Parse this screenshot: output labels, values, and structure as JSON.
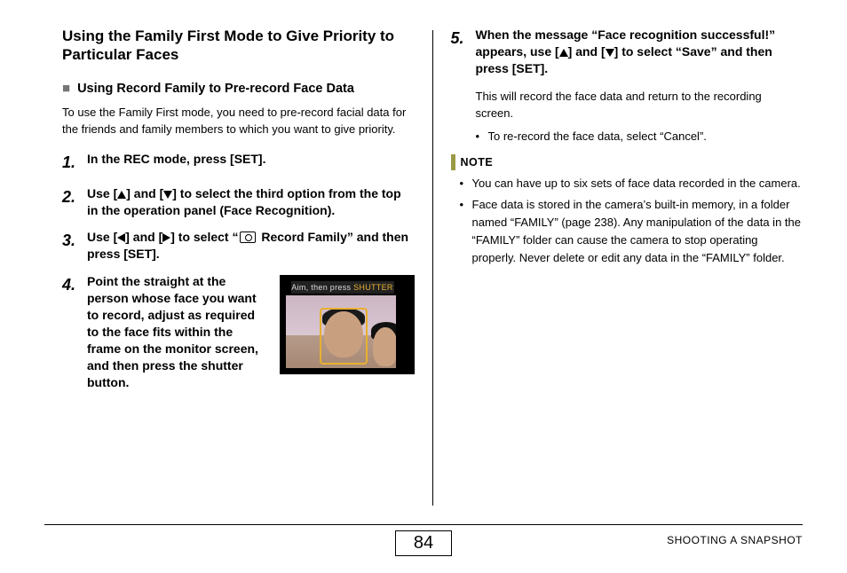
{
  "left": {
    "heading": "Using the Family First Mode to Give Priority to Particular Faces",
    "subheading": "Using Record Family to Pre-record Face Data",
    "intro": "To use the Family First mode, you need to pre-record facial data for the friends and family members to which you want to give priority.",
    "steps": {
      "s1": "In the REC mode, press [SET].",
      "s2a": "Use [",
      "s2b": "] and [",
      "s2c": "] to select the third option from the top in the operation panel (Face Recognition).",
      "s3a": "Use [",
      "s3b": "] and [",
      "s3c": "] to select “",
      "s3d": " Record Family” and then press [SET].",
      "s4": "Point the straight at the person whose face you want to record, adjust as required to the face fits within the frame on the monitor screen, and then press the shutter button."
    },
    "thumb_text_a": "Aim, then press ",
    "thumb_text_b": "SHUTTER"
  },
  "right": {
    "s5a": "When the message “Face recognition successful!” appears, use [",
    "s5b": "] and [",
    "s5c": "] to select “Save” and then press [SET].",
    "s5_sub": "This will record the face data and return to the recording screen.",
    "s5_bullet": "To re-record the face data, select “Cancel”.",
    "note_label": "NOTE",
    "notes": {
      "n1": "You can have up to six sets of face data recorded in the camera.",
      "n2": "Face data is stored in the camera’s built-in memory, in a folder named “FAMILY” (page 238). Any manipulation of the data in the “FAMILY” folder can cause the camera to stop operating properly. Never delete or edit any data in the “FAMILY” folder."
    }
  },
  "footer": {
    "page": "84",
    "chapter": "SHOOTING A SNAPSHOT"
  }
}
